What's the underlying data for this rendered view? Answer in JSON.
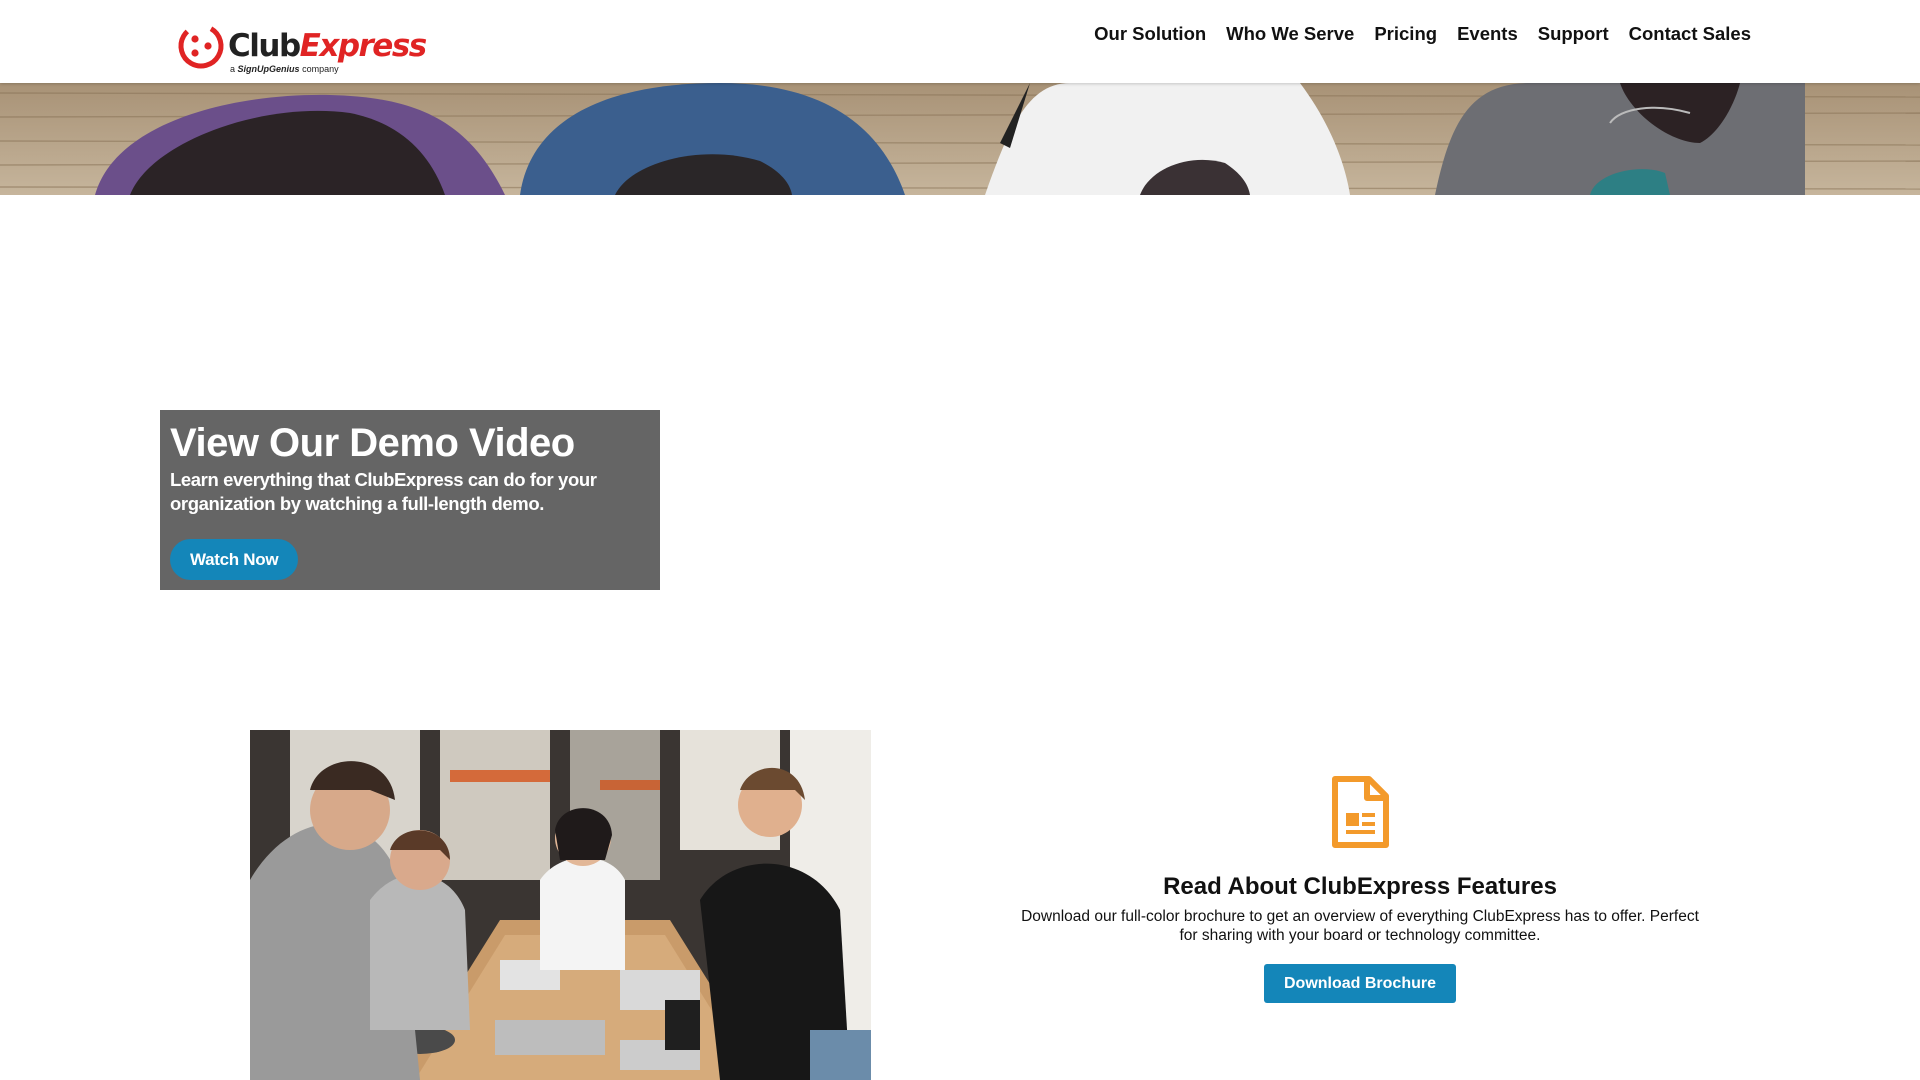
{
  "header": {
    "logo": {
      "word_club": "Club",
      "word_express": "Express",
      "tagline_prefix": "a",
      "tagline_brand": "SignUpGenius",
      "tagline_suffix": "company"
    },
    "nav": [
      {
        "label": "Our Solution"
      },
      {
        "label": "Who We Serve"
      },
      {
        "label": "Pricing"
      },
      {
        "label": "Events"
      },
      {
        "label": "Support"
      },
      {
        "label": "Contact Sales"
      }
    ]
  },
  "demo": {
    "title": "View Our Demo Video",
    "description": "Learn everything that ClubExpress can do for your organization by watching a full-length demo.",
    "button_label": "Watch Now"
  },
  "brochure": {
    "icon": "document-icon",
    "title": "Read About ClubExpress Features",
    "text": "Download our full-color brochure to get an overview of everything ClubExpress has to offer. Perfect for sharing with your board or technology committee.",
    "button_label": "Download Brochure"
  },
  "colors": {
    "brand_red": "#e02424",
    "button_blue": "#1486b9",
    "card_gray": "#656565",
    "icon_orange": "#f39a2b"
  }
}
